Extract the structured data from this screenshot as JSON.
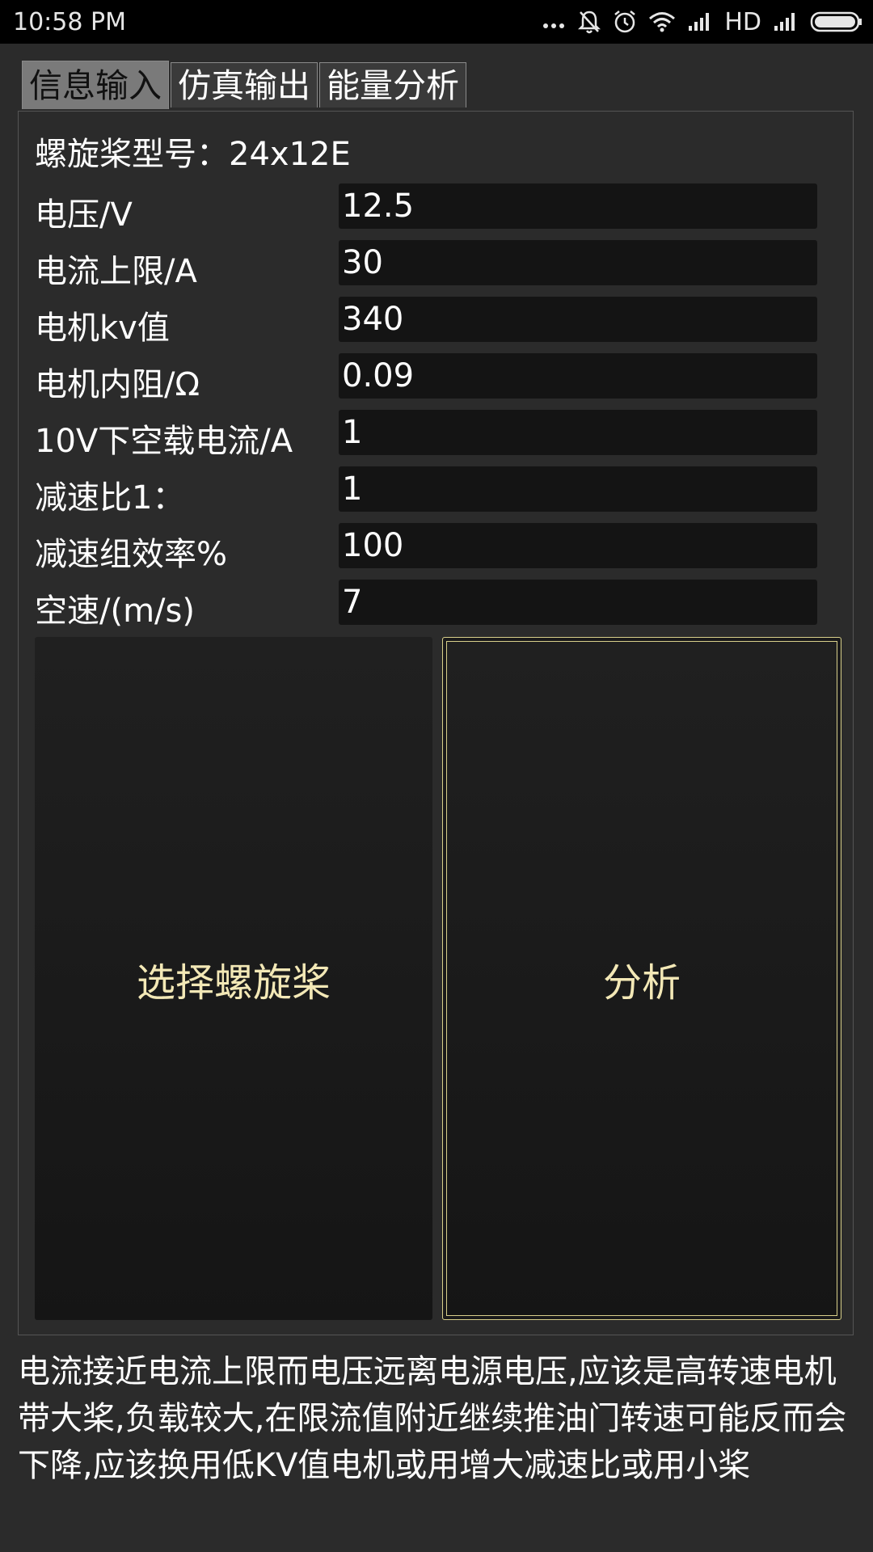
{
  "statusbar": {
    "time": "10:58 PM",
    "network": "HD",
    "icons": [
      "more-dots-icon",
      "bell-off-icon",
      "alarm-icon",
      "wifi-icon",
      "signal-icon",
      "signal-icon",
      "battery-icon"
    ]
  },
  "tabs": [
    {
      "label": "信息输入",
      "active": true
    },
    {
      "label": "仿真输出",
      "active": false
    },
    {
      "label": "能量分析",
      "active": false
    }
  ],
  "form": {
    "propeller_label": "螺旋桨型号：24x12E",
    "fields": [
      {
        "label": "电压/V",
        "value": "12.5"
      },
      {
        "label": "电流上限/A",
        "value": "30"
      },
      {
        "label": "电机kv值",
        "value": "340"
      },
      {
        "label": "电机内阻/Ω",
        "value": "0.09"
      },
      {
        "label": "10V下空载电流/A",
        "value": "1"
      },
      {
        "label": "减速比1：",
        "value": "1"
      },
      {
        "label": "减速组效率%",
        "value": "100"
      },
      {
        "label": "空速/(m/s)",
        "value": "7"
      }
    ]
  },
  "buttons": {
    "select_propeller": "选择螺旋桨",
    "analyze": "分析"
  },
  "message": "电流接近电流上限而电压远离电源电压,应该是高转速电机带大桨,负载较大,在限流值附近继续推油门转速可能反而会下降,应该换用低KV值电机或用增大减速比或用小桨",
  "colors": {
    "background": "#2b2b2b",
    "input_bg": "#141414",
    "button_text": "#f3e8b6",
    "focus_border": "#d8cf8a"
  }
}
